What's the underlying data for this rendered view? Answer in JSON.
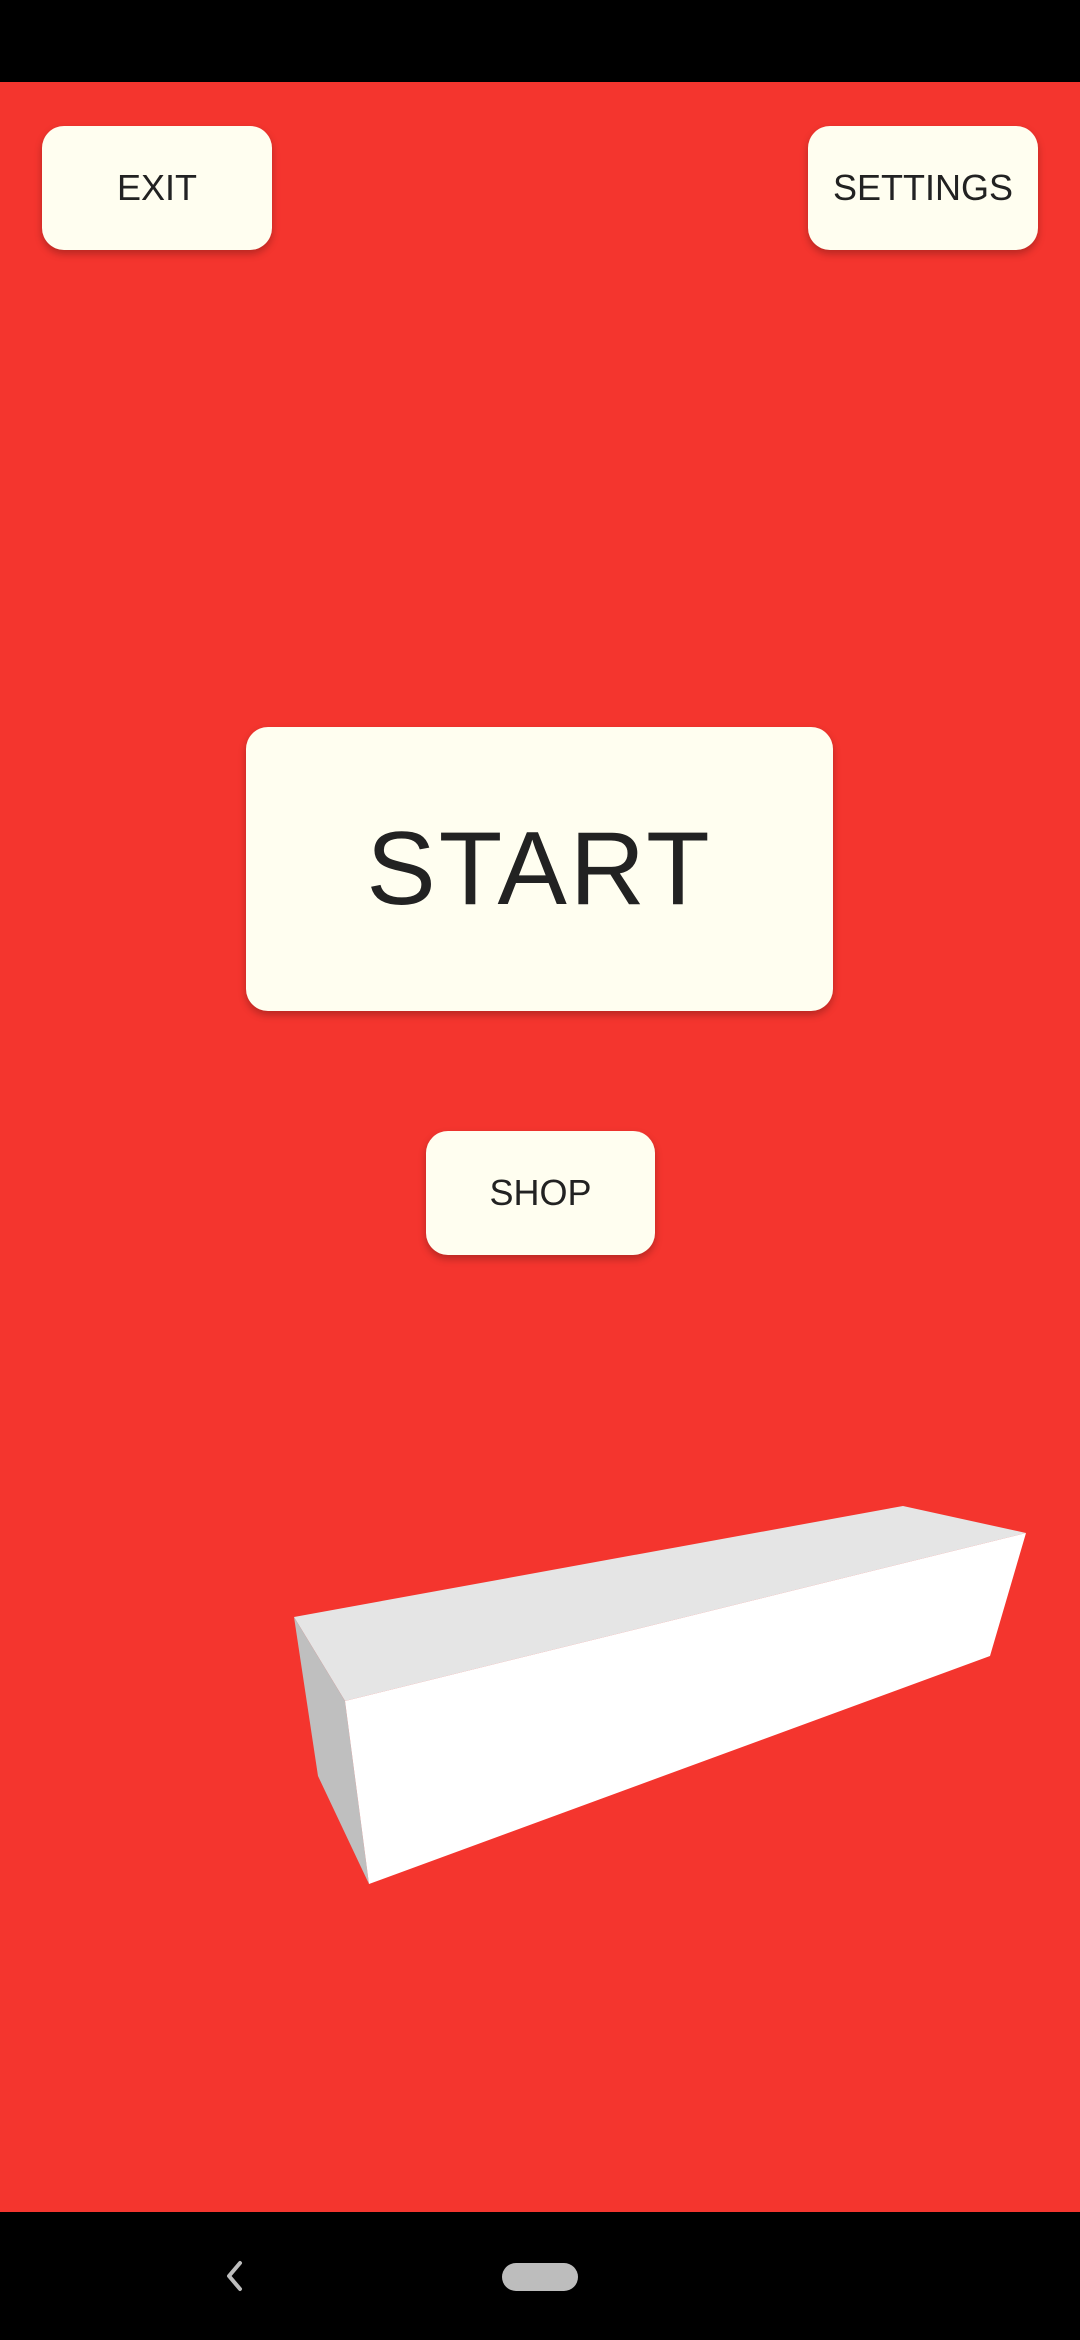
{
  "menu": {
    "exit_label": "EXIT",
    "settings_label": "SETTINGS",
    "start_label": "START",
    "shop_label": "SHOP"
  },
  "scene": {
    "background_color": "#F4352E",
    "button_color": "#FFFEF0",
    "button_text_color": "#222222",
    "block_color": "#FFFFFF"
  },
  "navigation": {
    "back_icon": "chevron-left-icon",
    "home_icon": "home-pill-icon"
  }
}
